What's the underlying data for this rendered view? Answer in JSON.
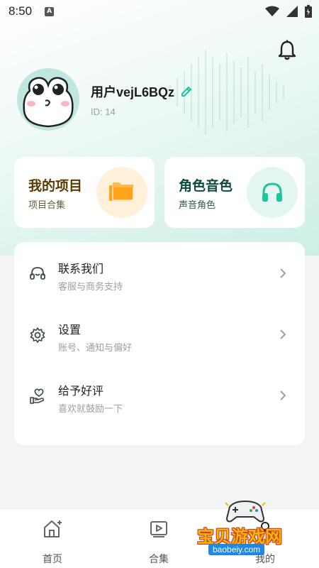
{
  "status_bar": {
    "time": "8:50",
    "badge": "A"
  },
  "profile": {
    "username": "用户vejL6BQz",
    "id_text": "ID: 14"
  },
  "cards": [
    {
      "title": "我的项目",
      "subtitle": "项目合集",
      "title_color": "#5a3a00",
      "subtitle_color": "#6b5a3c",
      "icon": "folder-icon"
    },
    {
      "title": "角色音色",
      "subtitle": "声音角色",
      "title_color": "#0e4a3f",
      "subtitle_color": "#355a53",
      "icon": "headphones-icon"
    }
  ],
  "menu": [
    {
      "title": "联系我们",
      "subtitle": "客服与商务支持",
      "icon": "customer-service-icon"
    },
    {
      "title": "设置",
      "subtitle": "账号、通知与偏好",
      "icon": "gear-icon"
    },
    {
      "title": "给予好评",
      "subtitle": "喜欢就鼓励一下",
      "icon": "heart-hand-icon"
    }
  ],
  "bottom_nav": [
    {
      "label": "首页",
      "icon": "home-icon"
    },
    {
      "label": "合集",
      "icon": "collection-icon"
    },
    {
      "label": "我的",
      "icon": "profile-icon"
    }
  ],
  "watermark": {
    "text": "宝贝游戏网",
    "url": "baobeiy.com"
  },
  "colors": {
    "accent": "#21c39a",
    "folder": "#ffa31a",
    "folder_bg": "#fff0d9",
    "headphone_bg": "#e3f6f1"
  }
}
